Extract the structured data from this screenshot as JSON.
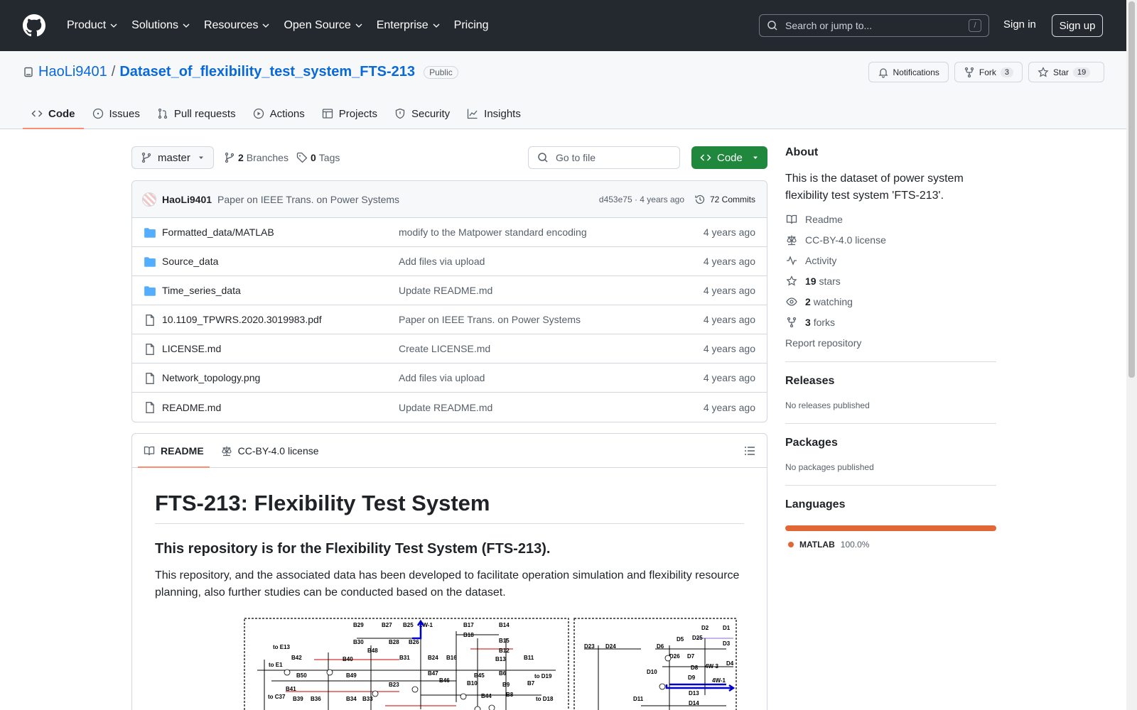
{
  "header": {
    "nav": [
      "Product",
      "Solutions",
      "Resources",
      "Open Source",
      "Enterprise",
      "Pricing"
    ],
    "search_placeholder": "Search or jump to...",
    "search_shortcut": "/",
    "sign_in": "Sign in",
    "sign_up": "Sign up"
  },
  "repo": {
    "owner": "HaoLi9401",
    "separator": "/",
    "name": "Dataset_of_flexibility_test_system_FTS-213",
    "visibility": "Public",
    "notifications": "Notifications",
    "fork_label": "Fork",
    "fork_count": "3",
    "star_label": "Star",
    "star_count": "19",
    "tabs": [
      "Code",
      "Issues",
      "Pull requests",
      "Actions",
      "Projects",
      "Security",
      "Insights"
    ]
  },
  "toolbar": {
    "branch": "master",
    "branches_count": "2",
    "branches_label": "Branches",
    "tags_count": "0",
    "tags_label": "Tags",
    "goto_placeholder": "Go to file",
    "code_label": "Code"
  },
  "commit": {
    "user": "HaoLi9401",
    "message": "Paper on IEEE Trans. on Power Systems",
    "meta": "d453e75 · 4 years ago",
    "count": "72 Commits"
  },
  "files": [
    {
      "name": "Formatted_data/MATLAB",
      "message": "modify to the Matpower standard encoding",
      "age": "4 years ago",
      "type": "dir"
    },
    {
      "name": "Source_data",
      "message": "Add files via upload",
      "age": "4 years ago",
      "type": "dir"
    },
    {
      "name": "Time_series_data",
      "message": "Update README.md",
      "age": "4 years ago",
      "type": "dir"
    },
    {
      "name": "10.1109_TPWRS.2020.3019983.pdf",
      "message": "Paper on IEEE Trans. on Power Systems",
      "age": "4 years ago",
      "type": "file"
    },
    {
      "name": "LICENSE.md",
      "message": "Create LICENSE.md",
      "age": "4 years ago",
      "type": "file"
    },
    {
      "name": "Network_topology.png",
      "message": "Add files via upload",
      "age": "4 years ago",
      "type": "file"
    },
    {
      "name": "README.md",
      "message": "Update README.md",
      "age": "4 years ago",
      "type": "file"
    }
  ],
  "readme": {
    "tab_readme": "README",
    "tab_license": "CC-BY-4.0 license",
    "h1": "FTS-213: Flexibility Test System",
    "h2": "This repository is for the Flexibility Test System (FTS-213).",
    "p": "This repository, and the associated data has been developed to facilitate operation simulation and flexibility resource planning, also further studies can be conducted based on the dataset.",
    "topology_labels": [
      "B29",
      "B27",
      "B25",
      "2W-1",
      "B17",
      "B14",
      "B30",
      "B28",
      "B26",
      "B18",
      "B15",
      "to E13",
      "B48",
      "B12",
      "B42",
      "B40",
      "B31",
      "B24",
      "B16",
      "B13",
      "B11",
      "to E1",
      "B50",
      "B49",
      "B47",
      "B45",
      "B6",
      "B46",
      "to D19",
      "B41",
      "B23",
      "B10",
      "B9",
      "B7",
      "to C37",
      "B39",
      "B36",
      "B34",
      "B33",
      "B44",
      "B8",
      "to D18",
      "D2",
      "D1",
      "D23",
      "D24",
      "D6",
      "D5",
      "D25",
      "D3",
      "D26",
      "D7",
      "4W-3",
      "D4",
      "D10",
      "D8",
      "D9",
      "4W-1",
      "D13",
      "D11",
      "D14"
    ]
  },
  "sidebar": {
    "about": "About",
    "description": "This is the dataset of power system flexibility test system 'FTS-213'.",
    "readme": "Readme",
    "license": "CC-BY-4.0 license",
    "activity": "Activity",
    "stars_count": "19",
    "stars_label": "stars",
    "watching_count": "2",
    "watching_label": "watching",
    "forks_count": "3",
    "forks_label": "forks",
    "report": "Report repository",
    "releases": "Releases",
    "releases_empty": "No releases published",
    "packages": "Packages",
    "packages_empty": "No packages published",
    "languages": "Languages",
    "lang_name": "MATLAB",
    "lang_pct": "100.0%",
    "lang_color": "#e16737"
  }
}
